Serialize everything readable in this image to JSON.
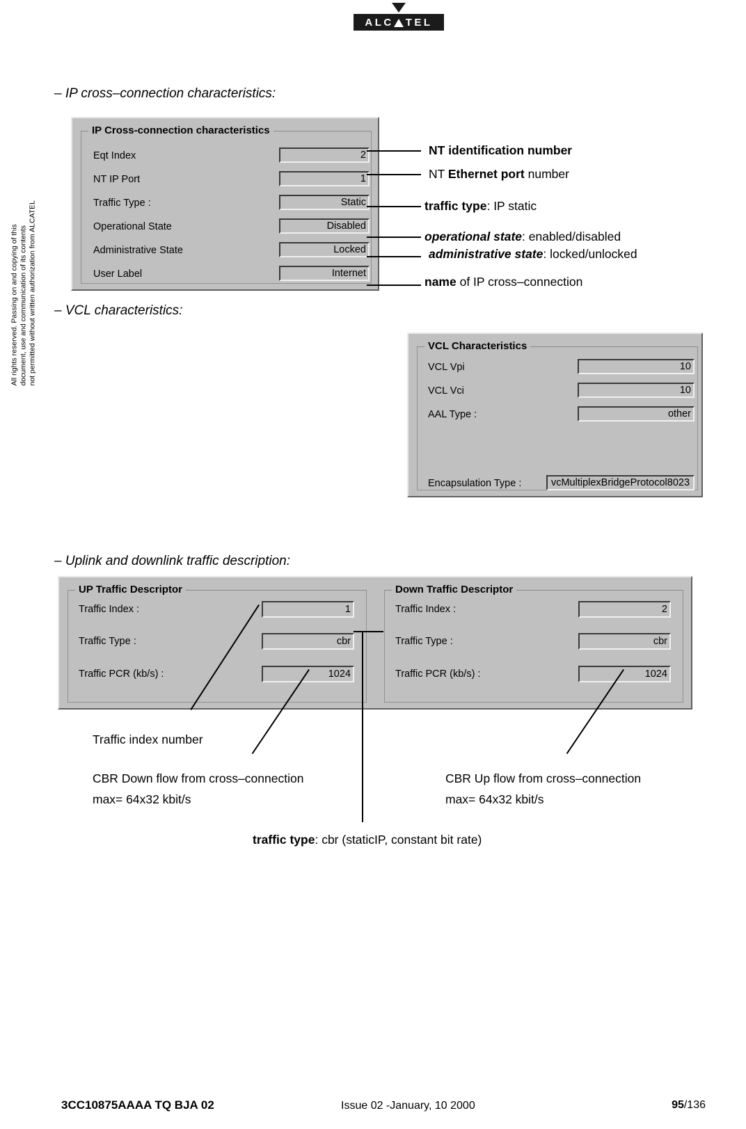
{
  "logo": {
    "brand": "ALCATEL",
    "letters_before_triangle": "ALC",
    "letters_after_triangle": "TEL"
  },
  "sidenote": {
    "line1": "All rights reserved. Passing on and copying of this",
    "line2": "document, use and communication of its contents",
    "line3": "not permitted without written authorization from ALCATEL"
  },
  "sections": {
    "ip_caption": "– IP cross–connection characteristics:",
    "vcl_caption": "– VCL characteristics:",
    "traffic_caption": "– Uplink and downlink traffic description:"
  },
  "ip_dialog": {
    "group_title": "IP Cross-connection characteristics",
    "fields": [
      {
        "label": "Eqt Index",
        "value": "2"
      },
      {
        "label": "NT IP Port",
        "value": "1"
      },
      {
        "label": "Traffic Type :",
        "value": "Static"
      },
      {
        "label": "Operational State",
        "value": "Disabled"
      },
      {
        "label": "Administrative State",
        "value": "Locked"
      },
      {
        "label": "User Label",
        "value": "Internet"
      }
    ]
  },
  "vcl_dialog": {
    "group_title": "VCL Characteristics",
    "fields": [
      {
        "label": "VCL Vpi",
        "value": "10"
      },
      {
        "label": "VCL Vci",
        "value": "10"
      },
      {
        "label": "AAL Type :",
        "value": "other"
      }
    ],
    "encapsulation_label": "Encapsulation Type :",
    "encapsulation_value": "vcMultiplexBridgeProtocol8023"
  },
  "up_traffic": {
    "group_title": "UP Traffic Descriptor",
    "fields": [
      {
        "label": "Traffic Index :",
        "value": "1"
      },
      {
        "label": "Traffic Type :",
        "value": "cbr"
      },
      {
        "label": "Traffic PCR (kb/s) :",
        "value": "1024"
      }
    ]
  },
  "down_traffic": {
    "group_title": "Down Traffic Descriptor",
    "fields": [
      {
        "label": "Traffic Index :",
        "value": "2"
      },
      {
        "label": "Traffic Type :",
        "value": "cbr"
      },
      {
        "label": "Traffic PCR (kb/s) :",
        "value": "1024"
      }
    ]
  },
  "annotations": {
    "nt_id_number": "NT identification number",
    "nt_eth_port_pre": "NT ",
    "nt_eth_port_bold": "Ethernet port",
    "nt_eth_port_post": " number",
    "traffic_type_bold": "traffic type",
    "traffic_type_rest": ": IP static",
    "operational_state_bold": "operational state",
    "operational_state_rest": ": enabled/disabled",
    "administrative_state_bold": "administrative state",
    "administrative_state_rest": ": locked/unlocked",
    "name_bold": "name",
    "name_rest": " of IP cross–connection",
    "traffic_index_number": "Traffic index number",
    "cbr_down_line1": "CBR Down flow from cross–connection",
    "cbr_down_line2": "max= 64x32 kbit/s",
    "cbr_up_line1": "CBR Up flow from cross–connection",
    "cbr_up_line2": "max= 64x32 kbit/s",
    "traffic_type_cbr_bold": "traffic type",
    "traffic_type_cbr_rest": ": cbr (staticIP, constant bit rate)"
  },
  "footer": {
    "doc_code": "3CC10875AAAA TQ BJA 02",
    "issue": "Issue 02 -January, 10 2000",
    "page": "95",
    "page_total": "/136"
  }
}
